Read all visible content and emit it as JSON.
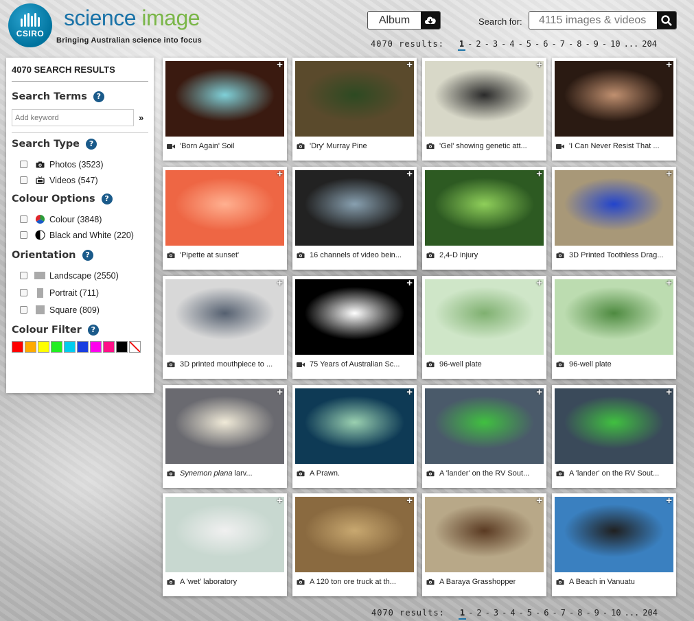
{
  "header": {
    "logo_text": "CSIRO",
    "brand_word1": "science",
    "brand_word2": "image",
    "tagline": "Bringing Australian science into focus",
    "album_label": "Album",
    "search_label": "Search for:",
    "search_placeholder": "4115 images & videos"
  },
  "pager": {
    "results_text": "4070 results:",
    "pages": [
      "1",
      "2",
      "3",
      "4",
      "5",
      "6",
      "7",
      "8",
      "9",
      "10"
    ],
    "current_page": "1",
    "ellipsis": "...",
    "last_page": "204"
  },
  "sidebar": {
    "results_title": "4070 SEARCH RESULTS",
    "search_terms_title": "Search Terms",
    "keyword_placeholder": "Add keyword",
    "keyword_go": "»",
    "help_glyph": "?",
    "search_type_title": "Search Type",
    "search_type_options": [
      {
        "label": "Photos (3523)",
        "icon": "camera-icon"
      },
      {
        "label": "Videos (547)",
        "icon": "video-icon"
      }
    ],
    "colour_options_title": "Colour Options",
    "colour_options": [
      {
        "label": "Colour (3848)",
        "icon": "colour-wheel-icon"
      },
      {
        "label": "Black and White (220)",
        "icon": "black-white-icon"
      }
    ],
    "orientation_title": "Orientation",
    "orientation_options": [
      {
        "label": "Landscape (2550)",
        "icon": "landscape-icon"
      },
      {
        "label": "Portrait (711)",
        "icon": "portrait-icon"
      },
      {
        "label": "Square (809)",
        "icon": "square-icon"
      }
    ],
    "colour_filter_title": "Colour Filter",
    "colour_swatches": [
      "#ff0000",
      "#ffaa00",
      "#ffff00",
      "#22ee22",
      "#00ccee",
      "#1a3ee0",
      "#ff00ee",
      "#ff1188",
      "#000000",
      "none"
    ]
  },
  "results": [
    {
      "caption": "'Born Again' Soil",
      "type": "video",
      "thumb_bg": "#3a1a10",
      "thumb_accent": "#7fd0d8"
    },
    {
      "caption": "'Dry' Murray Pine",
      "type": "photo",
      "thumb_bg": "#5a4a2c",
      "thumb_accent": "#2d4a22"
    },
    {
      "caption": "'Gel' showing genetic att...",
      "type": "photo",
      "thumb_bg": "#d8d8c8",
      "thumb_accent": "#2a2a2a"
    },
    {
      "caption": "'I Can Never Resist That ...",
      "type": "video",
      "thumb_bg": "#2a1a12",
      "thumb_accent": "#c09070"
    },
    {
      "caption": "'Pipette at sunset'",
      "type": "photo",
      "thumb_bg": "#ee6644",
      "thumb_accent": "#ffb090"
    },
    {
      "caption": "16 channels of video bein...",
      "type": "photo",
      "thumb_bg": "#222222",
      "thumb_accent": "#88a0b0"
    },
    {
      "caption": "2,4-D injury",
      "type": "photo",
      "thumb_bg": "#2d5a22",
      "thumb_accent": "#8fcf5a"
    },
    {
      "caption": "3D Printed Toothless Drag...",
      "type": "photo",
      "thumb_bg": "#a89878",
      "thumb_accent": "#2244cc"
    },
    {
      "caption": "3D printed mouthpiece to ...",
      "type": "photo",
      "thumb_bg": "#d8d8d8",
      "thumb_accent": "#556070"
    },
    {
      "caption": "75 Years of Australian Sc...",
      "type": "video",
      "thumb_bg": "#000000",
      "thumb_accent": "#ffffff"
    },
    {
      "caption": "96-well plate",
      "type": "photo",
      "thumb_bg": "#cfe6c8",
      "thumb_accent": "#7fb070"
    },
    {
      "caption": "96-well plate",
      "type": "photo",
      "thumb_bg": "#bcdcb0",
      "thumb_accent": "#4e8a40"
    },
    {
      "caption": "Synemon plana larv...",
      "type": "photo",
      "thumb_bg": "#6a6a70",
      "thumb_accent": "#f0ead8"
    },
    {
      "caption": "A Prawn.",
      "type": "photo",
      "thumb_bg": "#0e3a55",
      "thumb_accent": "#9ad0b0"
    },
    {
      "caption": "A 'lander' on the RV Sout...",
      "type": "photo",
      "thumb_bg": "#4a5a6a",
      "thumb_accent": "#40c040"
    },
    {
      "caption": "A 'lander' on the RV Sout...",
      "type": "photo",
      "thumb_bg": "#3a4a5a",
      "thumb_accent": "#40c040"
    },
    {
      "caption": "A 'wet' laboratory",
      "type": "photo",
      "thumb_bg": "#c8d8d0",
      "thumb_accent": "#f0f0f0"
    },
    {
      "caption": "A 120 ton ore truck at th...",
      "type": "photo",
      "thumb_bg": "#8a6a40",
      "thumb_accent": "#c8a870"
    },
    {
      "caption": "A Baraya Grasshopper",
      "type": "photo",
      "thumb_bg": "#b8a888",
      "thumb_accent": "#5a3a22"
    },
    {
      "caption": "A Beach in Vanuatu",
      "type": "photo",
      "thumb_bg": "#3a80c0",
      "thumb_accent": "#202020"
    }
  ],
  "results_italic_prefix": "Synemon plana",
  "results_italic_rest": " larv..."
}
